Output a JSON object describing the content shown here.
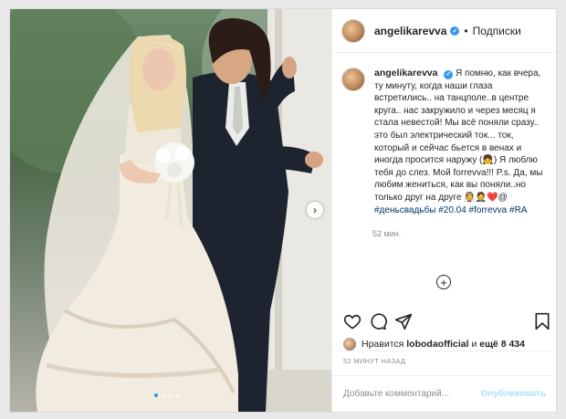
{
  "post": {
    "username": "angelikarevva",
    "follow_label": "Подписки",
    "separator": "•",
    "caption_username": "angelikarevva",
    "caption_text": "Я помню, как вчера, ту минуту, когда наши глаза встретились.. на танцполе..в центре круга.. нас закружило и через месяц я стала невестой! Мы всё поняли сразу.. это был электрический ток... ток, который и сейчас бьется в венах и иногда просится наружу (👧) Я люблю тебя до слез. Мой forrevva!!! P.s. Да, мы любим жениться, как вы поняли..но только друг на друге 👰🤵❤️@",
    "hashtags": "#деньсвадьбы #20.04 #forrevva #RA",
    "caption_time": "52 мин.",
    "likes_prefix": "Нравится",
    "likes_user": "lobodaofficial",
    "likes_connector": "и",
    "likes_more": "ещё 8 434",
    "posted_ago": "52 МИНУТ НАЗАД",
    "comment_placeholder": "Добавьте комментарий...",
    "publish_label": "Опубликовать",
    "next_glyph": "›",
    "plus_glyph": "+",
    "verified_glyph": "✓"
  },
  "carousel": {
    "total": 4,
    "active": 1
  },
  "colors": {
    "accent": "#3897f0",
    "active_dot": "#1e9bf0",
    "publish_disabled": "#b2dffc",
    "text": "#262626",
    "muted": "#8e8e8e"
  },
  "icons": [
    "heart-icon",
    "comment-icon",
    "share-icon",
    "bookmark-icon",
    "chevron-right-icon",
    "plus-circle-icon",
    "verified-icon"
  ]
}
